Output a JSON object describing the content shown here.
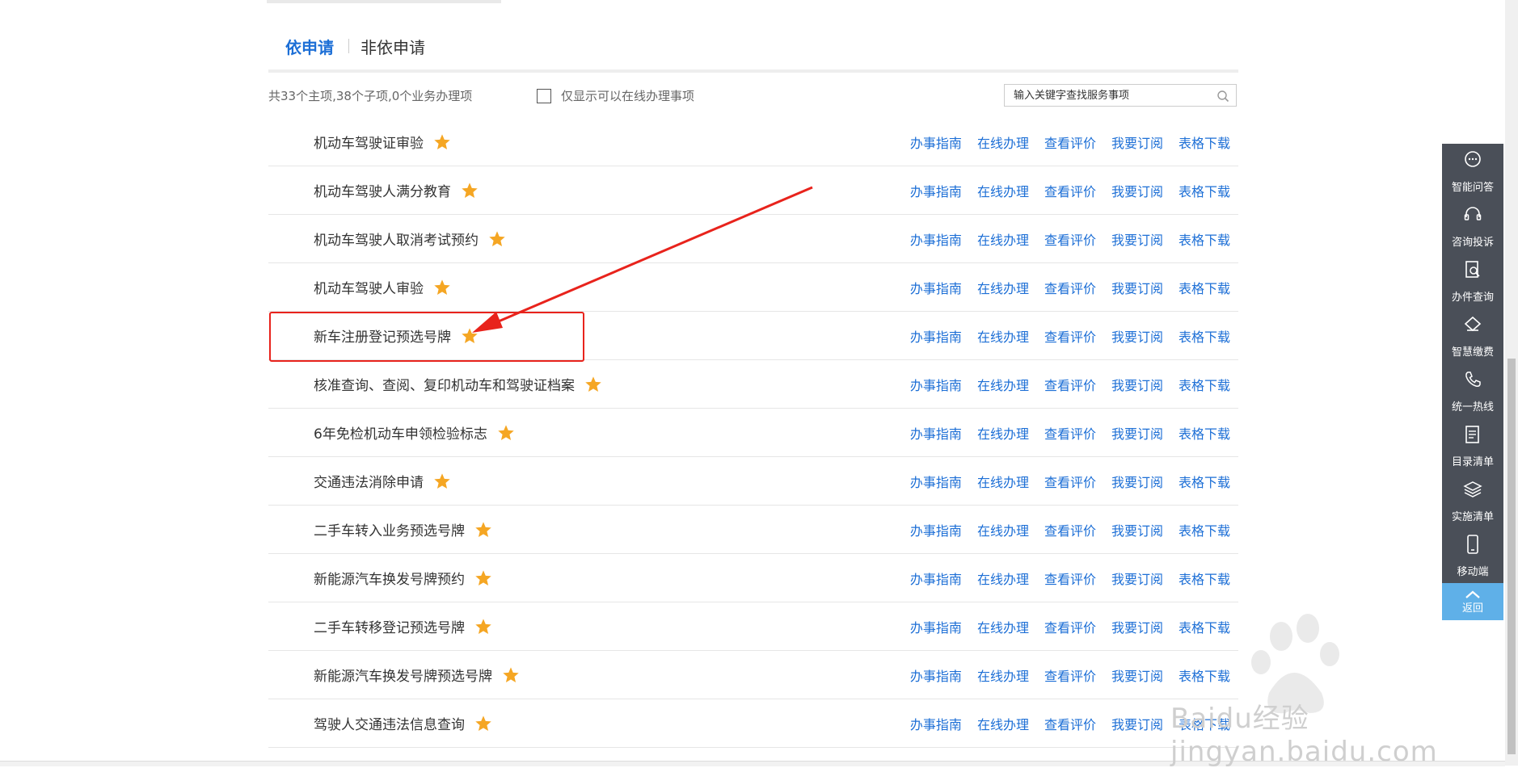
{
  "tabs": [
    "依申请",
    "非依申请"
  ],
  "summary": "共33个主项,38个子项,0个业务办理项",
  "online_only_label": "仅显示可以在线办理事项",
  "search": {
    "placeholder": "输入关键字查找服务事项",
    "value": ""
  },
  "actions": [
    "办事指南",
    "在线办理",
    "查看评价",
    "我要订阅",
    "表格下载"
  ],
  "items": [
    {
      "name": "机动车驾驶证审验"
    },
    {
      "name": "机动车驾驶人满分教育"
    },
    {
      "name": "机动车驾驶人取消考试预约"
    },
    {
      "name": "机动车驾驶人审验"
    },
    {
      "name": "新车注册登记预选号牌"
    },
    {
      "name": "核准查询、查阅、复印机动车和驾驶证档案"
    },
    {
      "name": "6年免检机动车申领检验标志"
    },
    {
      "name": "交通违法消除申请"
    },
    {
      "name": "二手车转入业务预选号牌"
    },
    {
      "name": "新能源汽车换发号牌预约"
    },
    {
      "name": "二手车转移登记预选号牌"
    },
    {
      "name": "新能源汽车换发号牌预选号牌"
    },
    {
      "name": "驾驶人交通违法信息查询"
    }
  ],
  "sidebar": [
    {
      "label": "智能问答",
      "icon": "chat-icon"
    },
    {
      "label": "咨询投诉",
      "icon": "headset-icon"
    },
    {
      "label": "办件查询",
      "icon": "document-search-icon"
    },
    {
      "label": "智慧缴费",
      "icon": "payment-icon"
    },
    {
      "label": "统一热线",
      "icon": "phone-icon"
    },
    {
      "label": "目录清单",
      "icon": "catalog-icon"
    },
    {
      "label": "实施清单",
      "icon": "layers-icon"
    },
    {
      "label": "移动端",
      "icon": "mobile-icon"
    }
  ],
  "back_label": "返回",
  "watermark": "Baidu经验 jingyan.baidu.com",
  "colors": {
    "accent": "#1d6fd6",
    "star": "#f5a623",
    "highlight": "#e8231c",
    "sidebar": "#4a4f58",
    "back": "#5fb0e8"
  }
}
